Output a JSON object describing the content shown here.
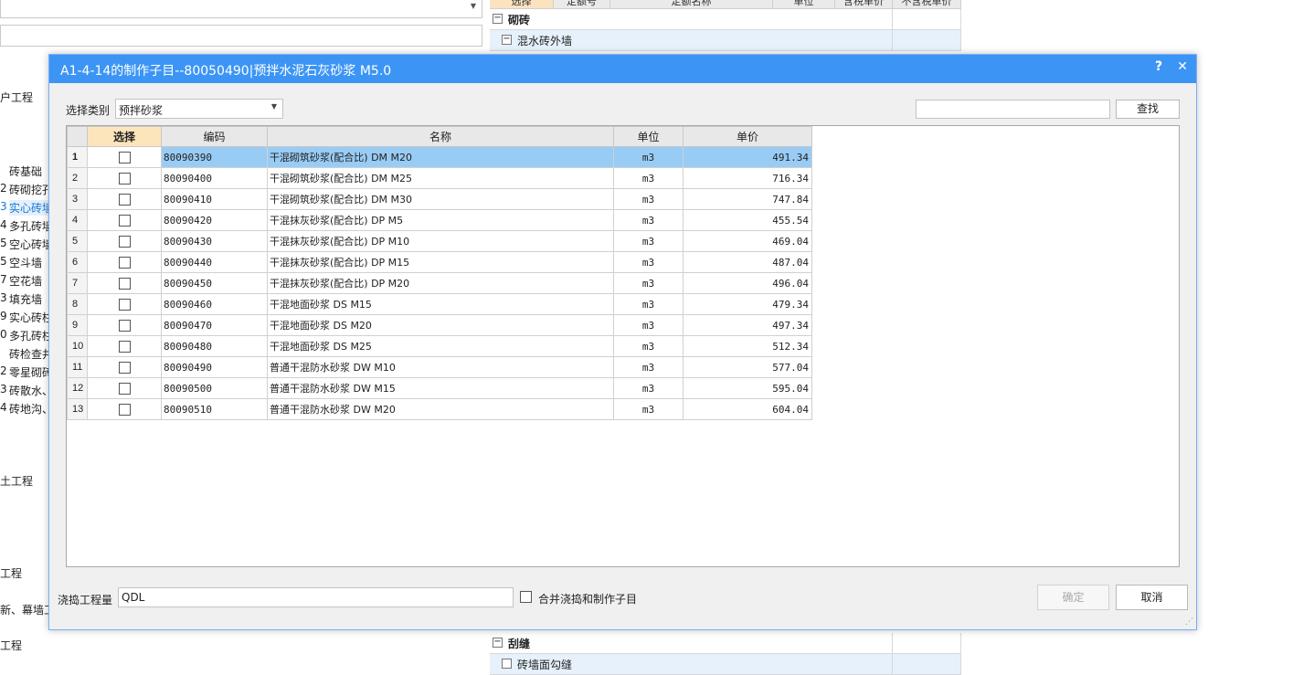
{
  "background": {
    "left_labels": [
      {
        "text": "户工程"
      },
      {
        "text": "砖基础"
      },
      {
        "text": "砖砌挖孔"
      },
      {
        "text": "实心砖墙"
      },
      {
        "text": "多孔砖墙"
      },
      {
        "text": "空心砖墙"
      },
      {
        "text": "空斗墙"
      },
      {
        "text": "空花墙"
      },
      {
        "text": "填充墙"
      },
      {
        "text": "实心砖柱"
      },
      {
        "text": "多孔砖柱"
      },
      {
        "text": "砖检查井"
      },
      {
        "text": "零星砌砖"
      },
      {
        "text": "砖散水、"
      },
      {
        "text": "砖地沟、"
      },
      {
        "text": "土工程"
      },
      {
        "text": "工程"
      },
      {
        "text": "新、幕墙工"
      },
      {
        "text": "工程"
      }
    ],
    "left_numbers": [
      "2",
      "3",
      "4",
      "5",
      "5",
      "7",
      "3",
      "9",
      "0",
      "2",
      "3",
      "4"
    ],
    "grid_header": [
      "选择",
      "定额号",
      "定额名称",
      "单位",
      "含税单价",
      "不含税单价"
    ],
    "grid_rows_top": [
      {
        "label": "砌砖",
        "box": "−"
      },
      {
        "label": "混水砖外墙",
        "box": "−"
      }
    ],
    "grid_rows_bottom": [
      {
        "label": "刮缝",
        "box": "−"
      },
      {
        "label": "砖墙面勾缝",
        "box": ""
      }
    ]
  },
  "dialog": {
    "title": "A1-4-14的制作子目--80050490|预拌水泥石灰砂浆 M5.0",
    "help_btn": "?",
    "close_btn": "✕",
    "category_label": "选择类别",
    "category_value": "预拌砂浆",
    "search_value": "",
    "find_button": "查找",
    "columns": {
      "select": "选择",
      "code": "编码",
      "name": "名称",
      "unit": "单位",
      "price": "单价"
    },
    "rows": [
      {
        "n": "1",
        "code": "80090390",
        "name": "干混砌筑砂浆(配合比) DM M20",
        "unit": "m3",
        "price": "491.34"
      },
      {
        "n": "2",
        "code": "80090400",
        "name": "干混砌筑砂浆(配合比) DM M25",
        "unit": "m3",
        "price": "716.34"
      },
      {
        "n": "3",
        "code": "80090410",
        "name": "干混砌筑砂浆(配合比) DM M30",
        "unit": "m3",
        "price": "747.84"
      },
      {
        "n": "4",
        "code": "80090420",
        "name": "干混抹灰砂浆(配合比) DP M5",
        "unit": "m3",
        "price": "455.54"
      },
      {
        "n": "5",
        "code": "80090430",
        "name": "干混抹灰砂浆(配合比) DP M10",
        "unit": "m3",
        "price": "469.04"
      },
      {
        "n": "6",
        "code": "80090440",
        "name": "干混抹灰砂浆(配合比) DP M15",
        "unit": "m3",
        "price": "487.04"
      },
      {
        "n": "7",
        "code": "80090450",
        "name": "干混抹灰砂浆(配合比) DP M20",
        "unit": "m3",
        "price": "496.04"
      },
      {
        "n": "8",
        "code": "80090460",
        "name": "干混地面砂浆 DS M15",
        "unit": "m3",
        "price": "479.34"
      },
      {
        "n": "9",
        "code": "80090470",
        "name": "干混地面砂浆 DS M20",
        "unit": "m3",
        "price": "497.34"
      },
      {
        "n": "10",
        "code": "80090480",
        "name": "干混地面砂浆 DS M25",
        "unit": "m3",
        "price": "512.34"
      },
      {
        "n": "11",
        "code": "80090490",
        "name": "普通干混防水砂浆 DW M10",
        "unit": "m3",
        "price": "577.04"
      },
      {
        "n": "12",
        "code": "80090500",
        "name": "普通干混防水砂浆 DW M15",
        "unit": "m3",
        "price": "595.04"
      },
      {
        "n": "13",
        "code": "80090510",
        "name": "普通干混防水砂浆 DW M20",
        "unit": "m3",
        "price": "604.04"
      }
    ],
    "selected_row": 1,
    "qty_label": "浇捣工程量",
    "qty_value": "QDL",
    "merge_label": "合并浇捣和制作子目",
    "ok_button": "确定",
    "cancel_button": "取消",
    "colors": {
      "titlebar": "#3c95f5",
      "selected_row": "#99ccf5",
      "select_header": "#fde5bb"
    }
  }
}
